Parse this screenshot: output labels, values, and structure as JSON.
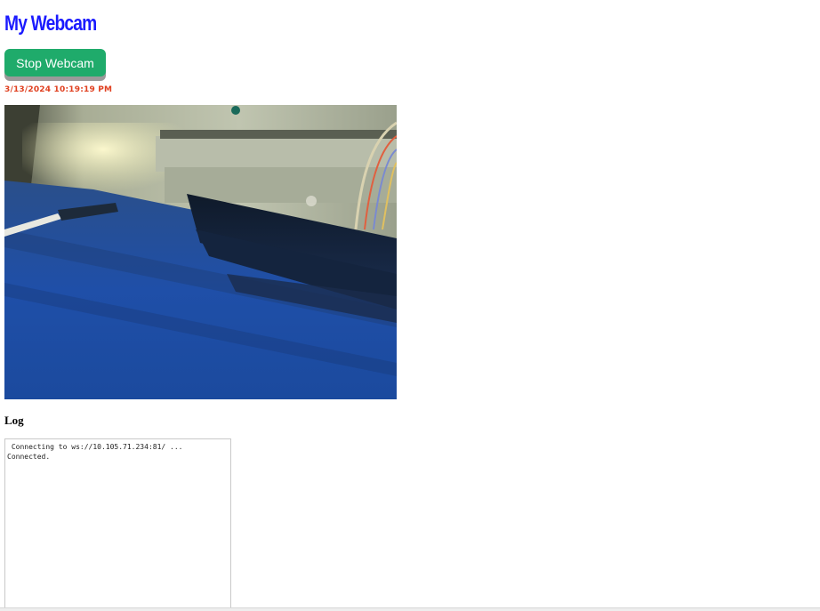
{
  "page": {
    "title": "My Webcam",
    "title_color": "#1a1aff"
  },
  "controls": {
    "stop_label": "Stop Webcam",
    "button_color": "#1fab6b"
  },
  "status": {
    "timestamp": "3/13/2024 10:19:19 PM",
    "timestamp_color": "#e04020"
  },
  "webcam": {
    "feed": "live-camera-frame"
  },
  "log": {
    "heading": "Log",
    "lines": [
      " Connecting to ws://10.105.71.234:81/ ...",
      "Connected."
    ]
  }
}
